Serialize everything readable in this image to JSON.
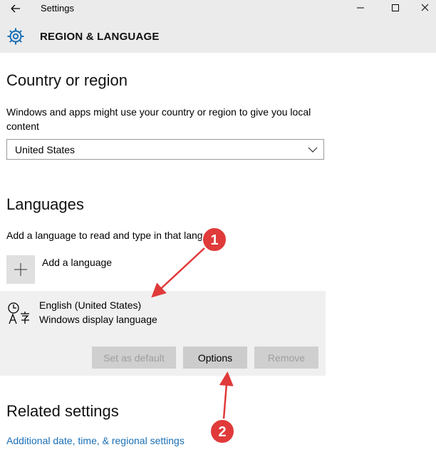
{
  "window": {
    "title": "Settings",
    "controls": [
      "minimize",
      "maximize",
      "close"
    ]
  },
  "header": {
    "page_title": "REGION & LANGUAGE",
    "icon": "gear-icon"
  },
  "country": {
    "heading": "Country or region",
    "description": "Windows and apps might use your country or region to give you local content",
    "selected": "United States"
  },
  "languages": {
    "heading": "Languages",
    "description": "Add a language to read and type in that language",
    "add_label": "Add a language",
    "items": [
      {
        "name": "English (United States)",
        "subtitle": "Windows display language"
      }
    ],
    "buttons": {
      "set_default": "Set as default",
      "options": "Options",
      "remove": "Remove"
    }
  },
  "related": {
    "heading": "Related settings",
    "link": "Additional date, time, & regional settings"
  },
  "annotations": {
    "marker_1": "1",
    "marker_2": "2",
    "color": "#e03a3a"
  },
  "colors": {
    "accent_link": "#1a6fb5",
    "titlebar_bg": "#ebebeb",
    "card_bg": "#f0f0f0"
  }
}
